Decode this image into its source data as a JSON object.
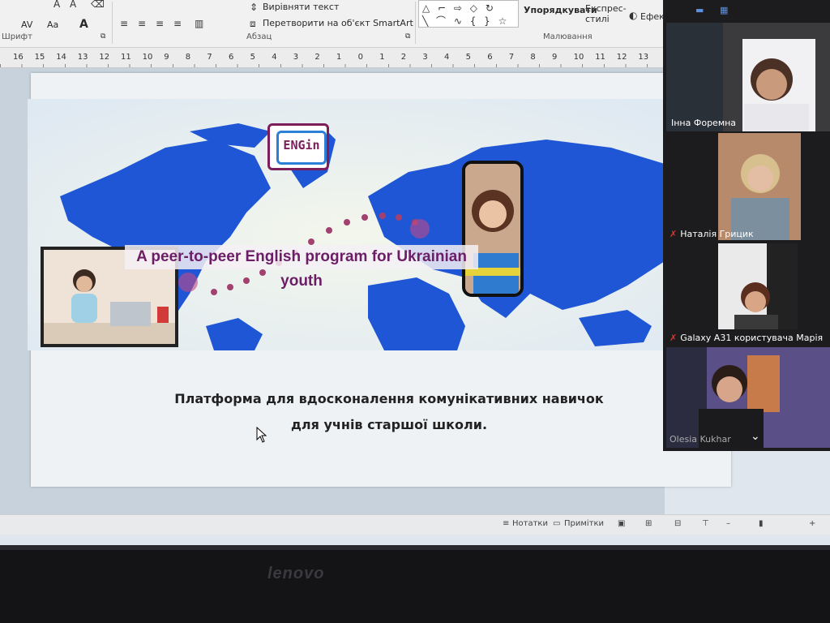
{
  "ribbon": {
    "font_group": "Шрифт",
    "paragraph_group": "Абзац",
    "drawing_group": "Малювання",
    "align_text": "Вирівняти текст",
    "convert_smartart": "Перетворити на об'єкт SmartArt",
    "arrange": "Упорядкувати",
    "quick_styles": "Експрес-стилі",
    "effects": "Ефект",
    "char_spacing": "AV",
    "change_case": "Aa",
    "font_color": "A"
  },
  "ruler": {
    "labels": [
      "16",
      "15",
      "14",
      "13",
      "12",
      "11",
      "10",
      "9",
      "8",
      "7",
      "6",
      "5",
      "4",
      "3",
      "2",
      "1",
      "0",
      "1",
      "2",
      "3",
      "4",
      "5",
      "6",
      "7",
      "8",
      "9",
      "10",
      "11",
      "12",
      "13"
    ]
  },
  "slide": {
    "logo_text": "ENGin",
    "tagline": "A peer-to-peer English program for Ukrainian youth",
    "caption_line1": "Платформа для вдосконалення комунікативних навичок",
    "caption_line2": "для учнів старшої школи."
  },
  "status_bar": {
    "notes": "Нотатки",
    "comments": "Примітки"
  },
  "zoom": {
    "participants": [
      {
        "name": "Інна Форемна",
        "muted": false
      },
      {
        "name": "Наталія Грицик",
        "muted": true
      },
      {
        "name": "Galaxy A31 користувача Марія",
        "muted": true
      },
      {
        "name": "Olesia Kukhar",
        "muted": false
      }
    ]
  },
  "device": {
    "brand": "lenovo"
  },
  "colors": {
    "map_blue": "#1e56d6",
    "tagline_purple": "#6b1d66",
    "mute_red": "#e0332d"
  }
}
